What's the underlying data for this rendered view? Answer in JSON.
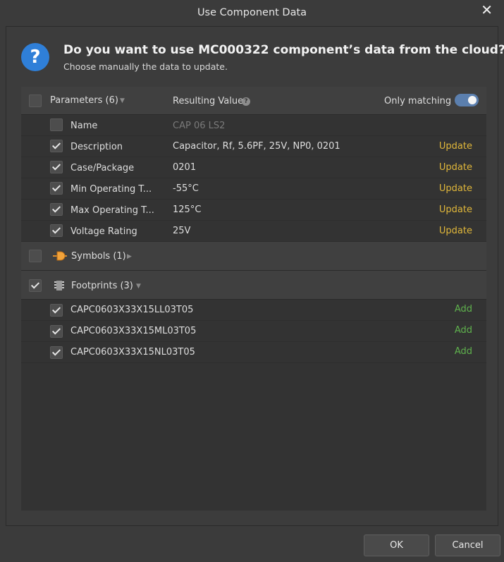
{
  "window": {
    "title": "Use Component Data"
  },
  "dialog": {
    "heading": "Do you want to use MC000322 component’s data from the cloud?",
    "subheading": "Choose manually the data to update."
  },
  "parameters": {
    "label": "Parameters (6)",
    "result_header": "Resulting Value",
    "only_matching_label": "Only matching",
    "only_matching_on": true,
    "items": [
      {
        "name": "Name",
        "value": "CAP 06 LS2",
        "checked": false,
        "action": ""
      },
      {
        "name": "Description",
        "value": "Capacitor, Rf, 5.6PF, 25V, NP0, 0201",
        "checked": true,
        "action": "Update"
      },
      {
        "name": "Case/Package",
        "value": "0201",
        "checked": true,
        "action": "Update"
      },
      {
        "name": "Min Operating T...",
        "value": "-55°C",
        "checked": true,
        "action": "Update"
      },
      {
        "name": "Max Operating T...",
        "value": "125°C",
        "checked": true,
        "action": "Update"
      },
      {
        "name": "Voltage Rating",
        "value": "25V",
        "checked": true,
        "action": "Update"
      }
    ]
  },
  "symbols": {
    "label": "Symbols (1)",
    "checked": false
  },
  "footprints": {
    "label": "Footprints (3)",
    "checked": true,
    "items": [
      {
        "name": "CAPC0603X33X15LL03T05",
        "checked": true,
        "action": "Add"
      },
      {
        "name": "CAPC0603X33X15ML03T05",
        "checked": true,
        "action": "Add"
      },
      {
        "name": "CAPC0603X33X15NL03T05",
        "checked": true,
        "action": "Add"
      }
    ]
  },
  "buttons": {
    "ok": "OK",
    "cancel": "Cancel"
  },
  "colors": {
    "update": "#e0b73a",
    "add": "#5fb24d",
    "toggle": "#5b7fae",
    "info": "#2f7fd8"
  }
}
